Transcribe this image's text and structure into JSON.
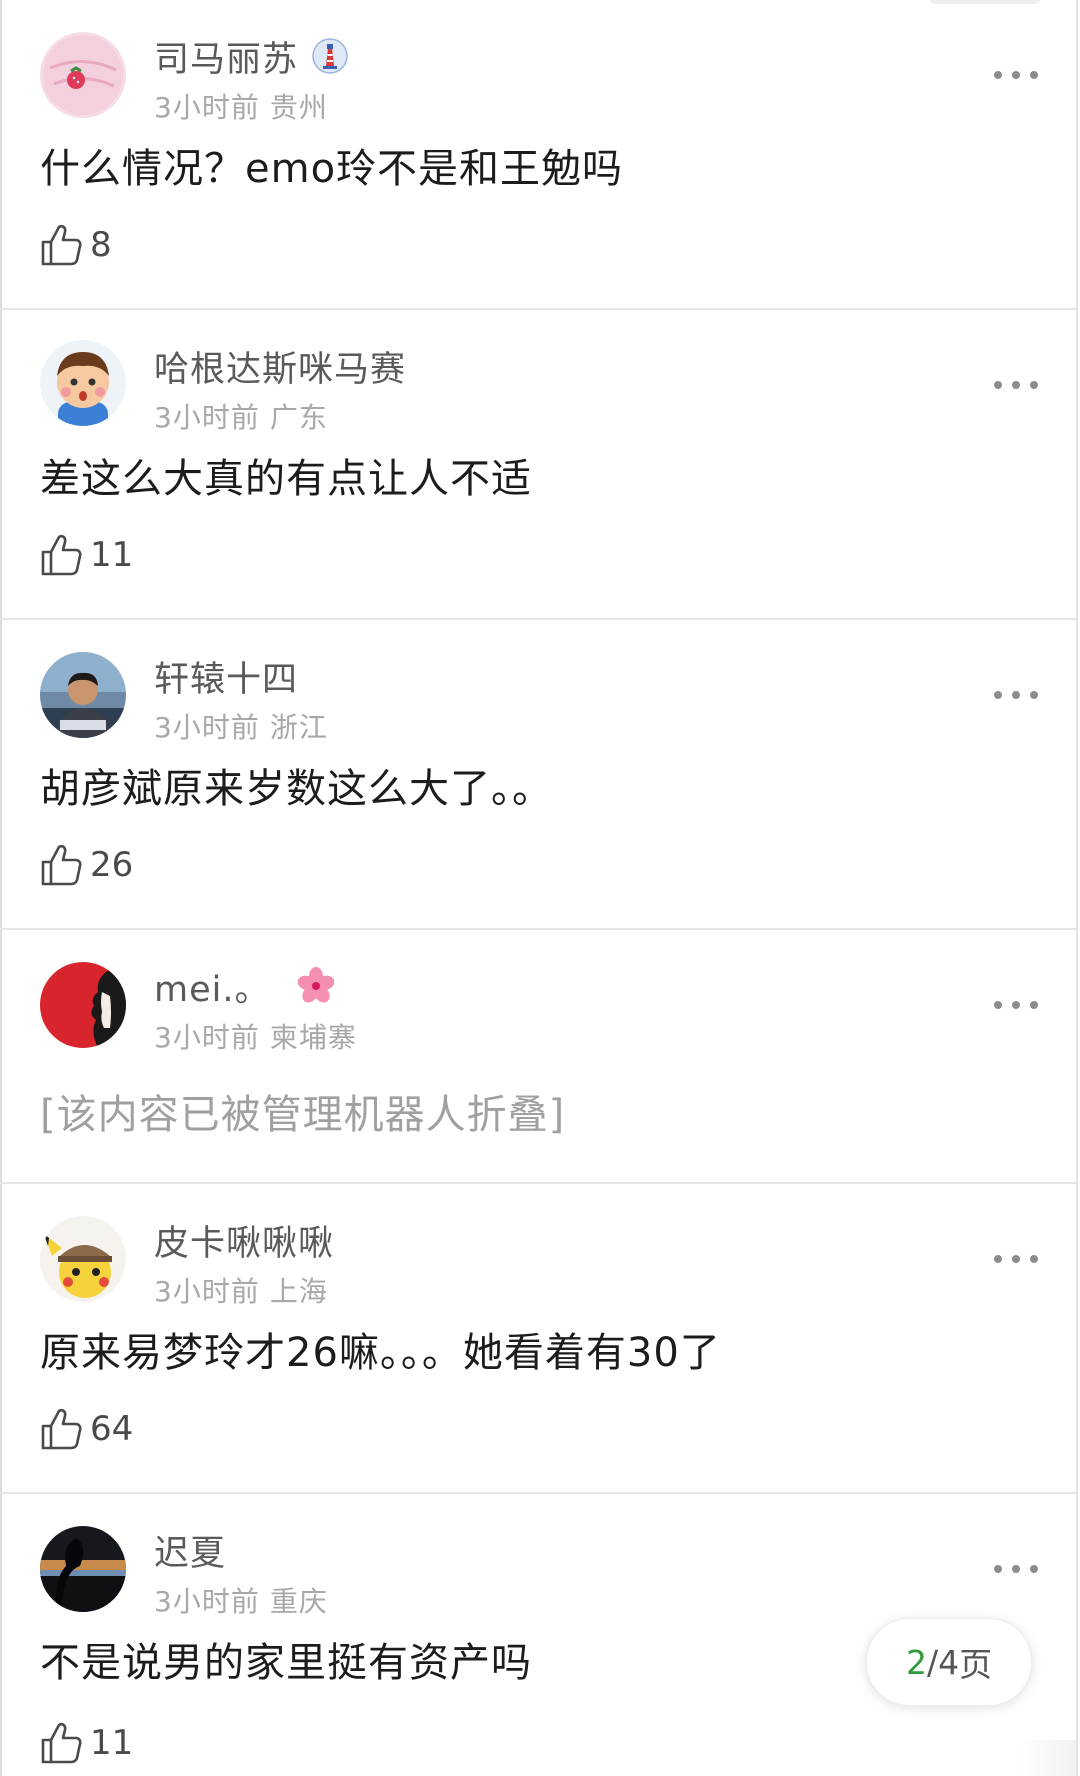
{
  "comments": [
    {
      "username": "司马丽苏",
      "time": "3小时前",
      "location": "贵州",
      "text": "什么情况？emo玲不是和王勉吗",
      "likes": "8",
      "badge": "lighthouse-badge-icon",
      "avatar": "strawberry-pink-avatar"
    },
    {
      "username": "哈根达斯咪马赛",
      "time": "3小时前",
      "location": "广东",
      "text": "差这么大真的有点让人不适",
      "likes": "11",
      "avatar": "cartoon-boy-avatar"
    },
    {
      "username": "轩辕十四",
      "time": "3小时前",
      "location": "浙江",
      "text": "胡彦斌原来岁数这么大了。。",
      "likes": "26",
      "avatar": "photo-man-avatar"
    },
    {
      "username": "mei.。",
      "time": "3小时前",
      "location": "柬埔寨",
      "text": "[该内容已被管理机器人折叠]",
      "likes": "",
      "badge": "cherry-blossom-badge-icon",
      "avatar": "red-profile-avatar",
      "folded": true
    },
    {
      "username": "皮卡啾啾啾",
      "time": "3小时前",
      "location": "上海",
      "text": "原来易梦玲才26嘛。。。她看着有30了",
      "likes": "64",
      "avatar": "pikachu-detective-avatar"
    },
    {
      "username": "迟夏",
      "time": "3小时前",
      "location": "重庆",
      "text": "不是说男的家里挺有资产吗",
      "likes": "11",
      "avatar": "dark-silhouette-avatar"
    }
  ],
  "pager": {
    "current": "2",
    "separator": "/",
    "total": "4",
    "unit": "页"
  },
  "colors": {
    "pager_current": "#2f9a3c",
    "username": "#5a5a5a",
    "meta": "#a8a8a8",
    "content": "#1c1c1c",
    "folded": "#a0a0a0"
  }
}
